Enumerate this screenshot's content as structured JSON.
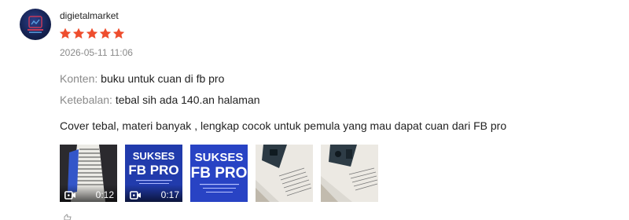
{
  "review": {
    "username": "digietalmarket",
    "rating": 5,
    "star_color": "#ee4d2d",
    "timestamp": "2026-05-11 11:06",
    "attributes": [
      {
        "label": "Konten:",
        "value": "buku untuk cuan di fb pro"
      },
      {
        "label": "Ketebalan:",
        "value": "tebal sih ada 140.an halaman"
      }
    ],
    "comment": "Cover tebal, materi banyak , lengkap cocok untuk pemula yang mau dapat cuan dari FB pro",
    "media": [
      {
        "type": "video",
        "duration": "0:12",
        "icon": "video-camera-icon"
      },
      {
        "type": "video",
        "duration": "0:17",
        "icon": "video-camera-icon"
      },
      {
        "type": "image",
        "cover_title_1": "SUKSES",
        "cover_title_2": "FB PRO"
      },
      {
        "type": "image"
      },
      {
        "type": "image"
      }
    ],
    "media_overlay_title_1": "SUKSES",
    "media_overlay_title_2": "FB PRO"
  }
}
